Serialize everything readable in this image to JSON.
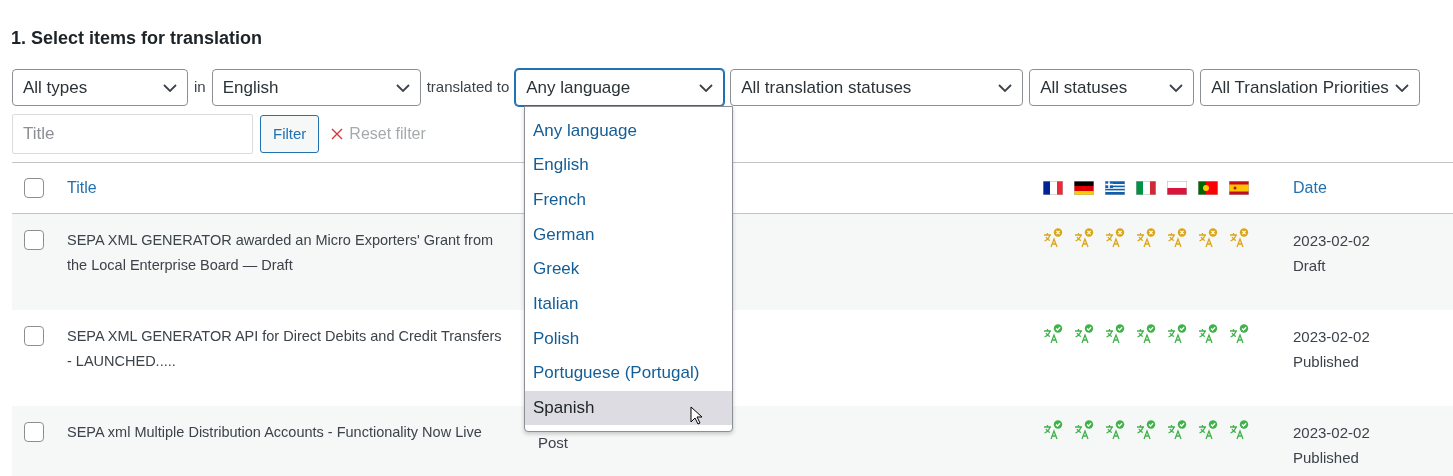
{
  "heading": "1. Select items for translation",
  "filters": {
    "type": {
      "value": "All types"
    },
    "in_label": "in",
    "source": {
      "value": "English"
    },
    "to_label": "translated to",
    "target": {
      "value": "Any language",
      "open": true
    },
    "translation_status": {
      "value": "All translation statuses"
    },
    "status": {
      "value": "All statuses"
    },
    "priority": {
      "value": "All Translation Priorities"
    },
    "title": {
      "placeholder": "Title"
    },
    "filter_button": "Filter",
    "reset": "Reset filter"
  },
  "dropdown_options": [
    {
      "label": "Any language",
      "selected": false
    },
    {
      "label": "English",
      "selected": false
    },
    {
      "label": "French",
      "selected": false
    },
    {
      "label": "German",
      "selected": false
    },
    {
      "label": "Greek",
      "selected": false
    },
    {
      "label": "Italian",
      "selected": false
    },
    {
      "label": "Polish",
      "selected": false
    },
    {
      "label": "Portuguese (Portugal)",
      "selected": false
    },
    {
      "label": "Spanish",
      "selected": true
    }
  ],
  "table": {
    "header_checkbox": {
      "checked": false
    },
    "columns": {
      "title": "Title",
      "date": "Date"
    },
    "languages": [
      {
        "kind": "fr"
      },
      {
        "kind": "de"
      },
      {
        "kind": "gr"
      },
      {
        "kind": "it"
      },
      {
        "kind": "pl"
      },
      {
        "kind": "pt"
      },
      {
        "kind": "es"
      }
    ],
    "rows": [
      {
        "checked": false,
        "title": "SEPA XML GENERATOR awarded an Micro Exporters' Grant from the Local Enterprise Board — Draft",
        "translations": [
          {
            "done": false
          },
          {
            "done": false
          },
          {
            "done": false
          },
          {
            "done": false
          },
          {
            "done": false
          },
          {
            "done": false
          },
          {
            "done": false
          }
        ],
        "date": "2023-02-02",
        "status": "Draft"
      },
      {
        "checked": false,
        "title": "SEPA XML GENERATOR API for Direct Debits and Credit Transfers - LAUNCHED.....",
        "translations": [
          {
            "done": true
          },
          {
            "done": true
          },
          {
            "done": true
          },
          {
            "done": true
          },
          {
            "done": true
          },
          {
            "done": true
          },
          {
            "done": true
          }
        ],
        "date": "2023-02-02",
        "status": "Published"
      },
      {
        "checked": false,
        "title": "SEPA xml Multiple Distribution Accounts - Functionality Now Live",
        "column_2": "Post",
        "translations": [
          {
            "done": true
          },
          {
            "done": true
          },
          {
            "done": true
          },
          {
            "done": true
          },
          {
            "done": true
          },
          {
            "done": true
          },
          {
            "done": true
          }
        ],
        "date": "2023-02-02",
        "status": "Published"
      }
    ]
  }
}
